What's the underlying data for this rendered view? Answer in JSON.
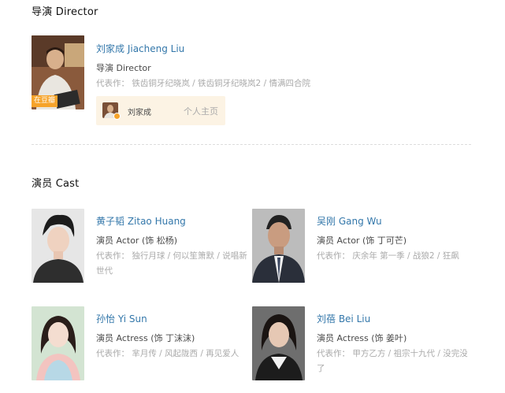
{
  "director_section": {
    "title": "导演 Director",
    "director": {
      "name": "刘家成 Jiacheng Liu",
      "role": "导演 Director",
      "works_label": "代表作：",
      "works_text": "铁齿铜牙纪晓岚 / 铁齿铜牙纪晓岚2 / 情满四合院",
      "badge": "在豆瓣",
      "homepage": {
        "name": "刘家成",
        "link_label": "个人主页"
      }
    }
  },
  "cast_section": {
    "title": "演员 Cast",
    "members": [
      {
        "name": "黄子韬 Zitao Huang",
        "role": "演员 Actor (饰 松杨)",
        "works_label": "代表作：",
        "works_text": "独行月球 / 何以笙箫默 / 说唱新世代"
      },
      {
        "name": "吴刚 Gang Wu",
        "role": "演员 Actor (饰 丁可芒)",
        "works_label": "代表作：",
        "works_text": "庆余年 第一季 / 战狼2 / 狂飙"
      },
      {
        "name": "孙怡 Yi Sun",
        "role": "演员 Actress (饰 丁沫沫)",
        "works_label": "代表作：",
        "works_text": "芈月传 / 风起陇西 / 再见爱人"
      },
      {
        "name": "刘蓓 Bei Liu",
        "role": "演员 Actress (饰 姜叶)",
        "works_label": "代表作：",
        "works_text": "甲方乙方 / 祖宗十九代 / 没完没了"
      }
    ]
  },
  "colors": {
    "link": "#3377aa",
    "badge": "#f6a32a",
    "card_bg": "#fcf3e4",
    "muted": "#aaaaaa"
  }
}
